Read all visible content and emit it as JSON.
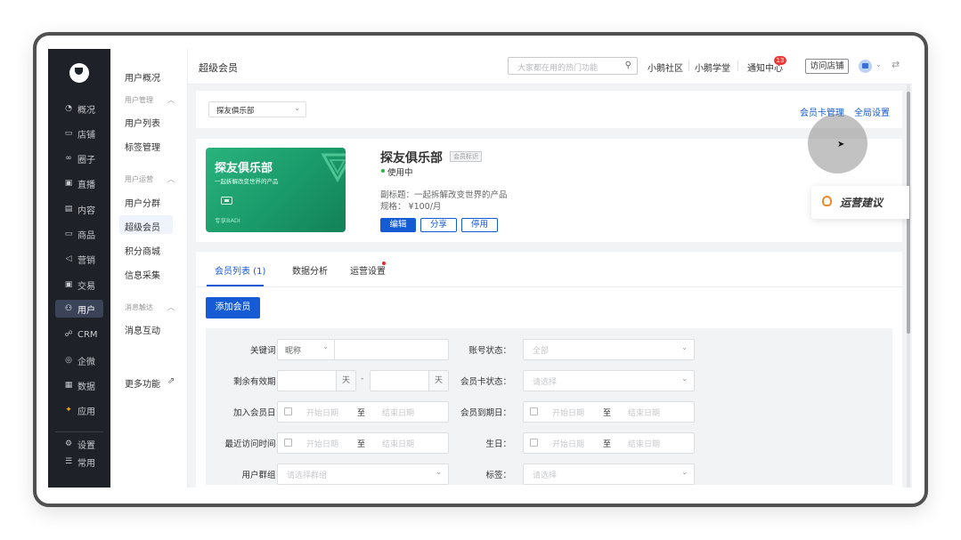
{
  "rail": {
    "items": [
      {
        "icon": "pie-chart-icon",
        "label": "概况"
      },
      {
        "icon": "store-icon",
        "label": "店铺"
      },
      {
        "icon": "circle-group-icon",
        "label": "圈子"
      },
      {
        "icon": "live-icon",
        "label": "直播"
      },
      {
        "icon": "content-icon",
        "label": "内容"
      },
      {
        "icon": "goods-icon",
        "label": "商品"
      },
      {
        "icon": "megaphone-icon",
        "label": "营销"
      },
      {
        "icon": "trade-icon",
        "label": "交易"
      },
      {
        "icon": "user-icon",
        "label": "用户"
      },
      {
        "icon": "crm-icon",
        "label": "CRM"
      },
      {
        "icon": "wecom-icon",
        "label": "企微"
      },
      {
        "icon": "data-icon",
        "label": "数据"
      },
      {
        "icon": "apps-icon",
        "label": "应用"
      },
      {
        "icon": "settings-icon",
        "label": "设置"
      },
      {
        "icon": "common-icon",
        "label": "常用"
      }
    ],
    "active_index": 8
  },
  "subnav": {
    "overview": "用户概况",
    "group1": "用户管理",
    "user_list": "用户列表",
    "tag_manage": "标签管理",
    "group2": "用户运营",
    "segmentation": "用户分群",
    "super_member": "超级会员",
    "points_mall": "积分商城",
    "info_collect": "信息采集",
    "group3": "消息触达",
    "msg_interact": "消息互动",
    "more": "更多功能"
  },
  "header": {
    "title": "超级会员",
    "search_placeholder": "大家都在用的热门功能",
    "community": "小鹅社区",
    "school": "小鹅学堂",
    "notify": "通知中心",
    "notify_badge": "13",
    "visit_store": "访问店铺"
  },
  "top_card": {
    "club_select": "探友俱乐部",
    "card_manage": "会员卡管理",
    "global_settings": "全局设置"
  },
  "member_card": {
    "title": "探友俱乐部",
    "subtitle": "一起拆解改变世界的产品",
    "footer": "专享BADI",
    "name": "探友俱乐部",
    "tag": "会员标识",
    "status": "使用中",
    "sub_title_line": "副标题：一起拆解改变世界的产品",
    "spec_line": "规格：  ¥100/月",
    "btn_edit": "编辑",
    "btn_share": "分享",
    "btn_disable": "停用"
  },
  "tabs": {
    "member_list": "会员列表  (1)",
    "data_analysis": "数据分析",
    "ops_settings": "运营设置"
  },
  "add_member": "添加会员",
  "filters": {
    "keyword_label": "关键词：",
    "keyword_prefix": "昵称",
    "account_status_label": "账号状态：",
    "account_status_value": "全部",
    "remaining_label": "剩余有效期：",
    "day_unit": "天",
    "range_dash": "-",
    "card_status_label": "会员卡状态：",
    "select_placeholder": "请选择",
    "join_date_label": "加入会员日：",
    "start_date": "开始日期",
    "to": "至",
    "end_date": "结束日期",
    "expire_date_label": "会员到期日：",
    "last_visit_label": "最近访问时间：",
    "birthday_label": "生日：",
    "user_group_label": "用户群组：",
    "user_group_placeholder": "请选择群组",
    "tag_label": "标签："
  },
  "advice": {
    "label": "运营建议"
  },
  "colors": {
    "primary": "#155bd4",
    "rail_bg": "#1e2128",
    "card_green": "#1a9a6a",
    "badge_red": "#ee3a36"
  }
}
